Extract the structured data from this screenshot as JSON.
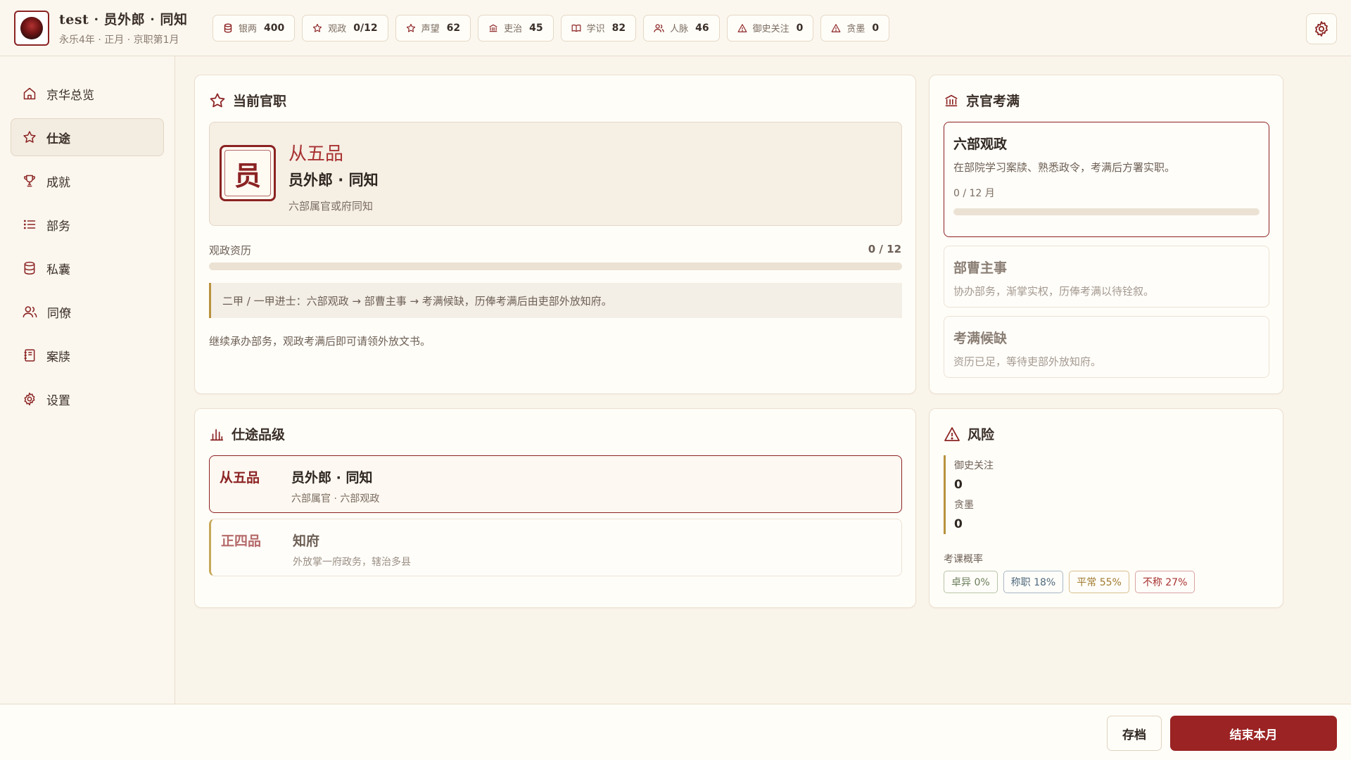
{
  "header": {
    "title": "test · 员外郎 · 同知",
    "subtitle": "永乐4年 · 正月 · 京职第1月",
    "stats": [
      {
        "icon": "coins-icon",
        "label": "银两",
        "value": "400"
      },
      {
        "icon": "star-icon",
        "label": "观政",
        "value": "0/12"
      },
      {
        "icon": "star-icon",
        "label": "声望",
        "value": "62"
      },
      {
        "icon": "bank-icon",
        "label": "吏治",
        "value": "45"
      },
      {
        "icon": "book-icon",
        "label": "学识",
        "value": "82"
      },
      {
        "icon": "people-icon",
        "label": "人脉",
        "value": "46"
      },
      {
        "icon": "warning-icon",
        "label": "御史关注",
        "value": "0"
      },
      {
        "icon": "warning-icon",
        "label": "贪墨",
        "value": "0"
      }
    ]
  },
  "sidebar": {
    "items": [
      {
        "label": "京华总览",
        "icon": "home-icon"
      },
      {
        "label": "仕途",
        "icon": "star-icon"
      },
      {
        "label": "成就",
        "icon": "trophy-icon"
      },
      {
        "label": "部务",
        "icon": "list-icon"
      },
      {
        "label": "私囊",
        "icon": "database-icon"
      },
      {
        "label": "同僚",
        "icon": "people-icon"
      },
      {
        "label": "案牍",
        "icon": "notebook-icon"
      },
      {
        "label": "设置",
        "icon": "gear-icon"
      }
    ]
  },
  "current_post": {
    "title": "当前官职",
    "seal": "员",
    "rank": "从五品",
    "name": "员外郎 · 同知",
    "desc": "六部属官或府同知",
    "progress_label": "观政资历",
    "progress_value": "0 / 12",
    "progress_fraction": 0,
    "note": "二甲 / 一甲进士：六部观政 → 部曹主事 → 考满候缺，历俸考满后由吏部外放知府。",
    "hint": "继续承办部务，观政考满后即可请领外放文书。"
  },
  "jingguan": {
    "title": "京官考满",
    "stages": [
      {
        "title": "六部观政",
        "desc": "在部院学习案牍、熟悉政令，考满后方署实职。",
        "progress": "0 / 12 月",
        "fraction": 0
      },
      {
        "title": "部曹主事",
        "desc": "协办部务，渐掌实权，历俸考满以待铨叙。"
      },
      {
        "title": "考满候缺",
        "desc": "资历已足，等待吏部外放知府。"
      }
    ]
  },
  "career": {
    "title": "仕途品级",
    "ranks": [
      {
        "grade": "从五品",
        "name": "员外郎 · 同知",
        "desc": "六部属官 · 六部观政"
      },
      {
        "grade": "正四品",
        "name": "知府",
        "desc": "外放掌一府政务，辖治多县"
      }
    ]
  },
  "risk": {
    "title": "风险",
    "items": [
      {
        "label": "御史关注",
        "value": "0"
      },
      {
        "label": "贪墨",
        "value": "0"
      }
    ],
    "prob_title": "考课概率",
    "probs": [
      {
        "label": "卓异 0%"
      },
      {
        "label": "称职 18%"
      },
      {
        "label": "平常 55%"
      },
      {
        "label": "不称 27%"
      }
    ]
  },
  "footer": {
    "save_label": "存档",
    "end_label": "结束本月"
  },
  "colors": {
    "accent": "#9b2323",
    "gold": "#b8923e",
    "background": "#faf5eb"
  }
}
